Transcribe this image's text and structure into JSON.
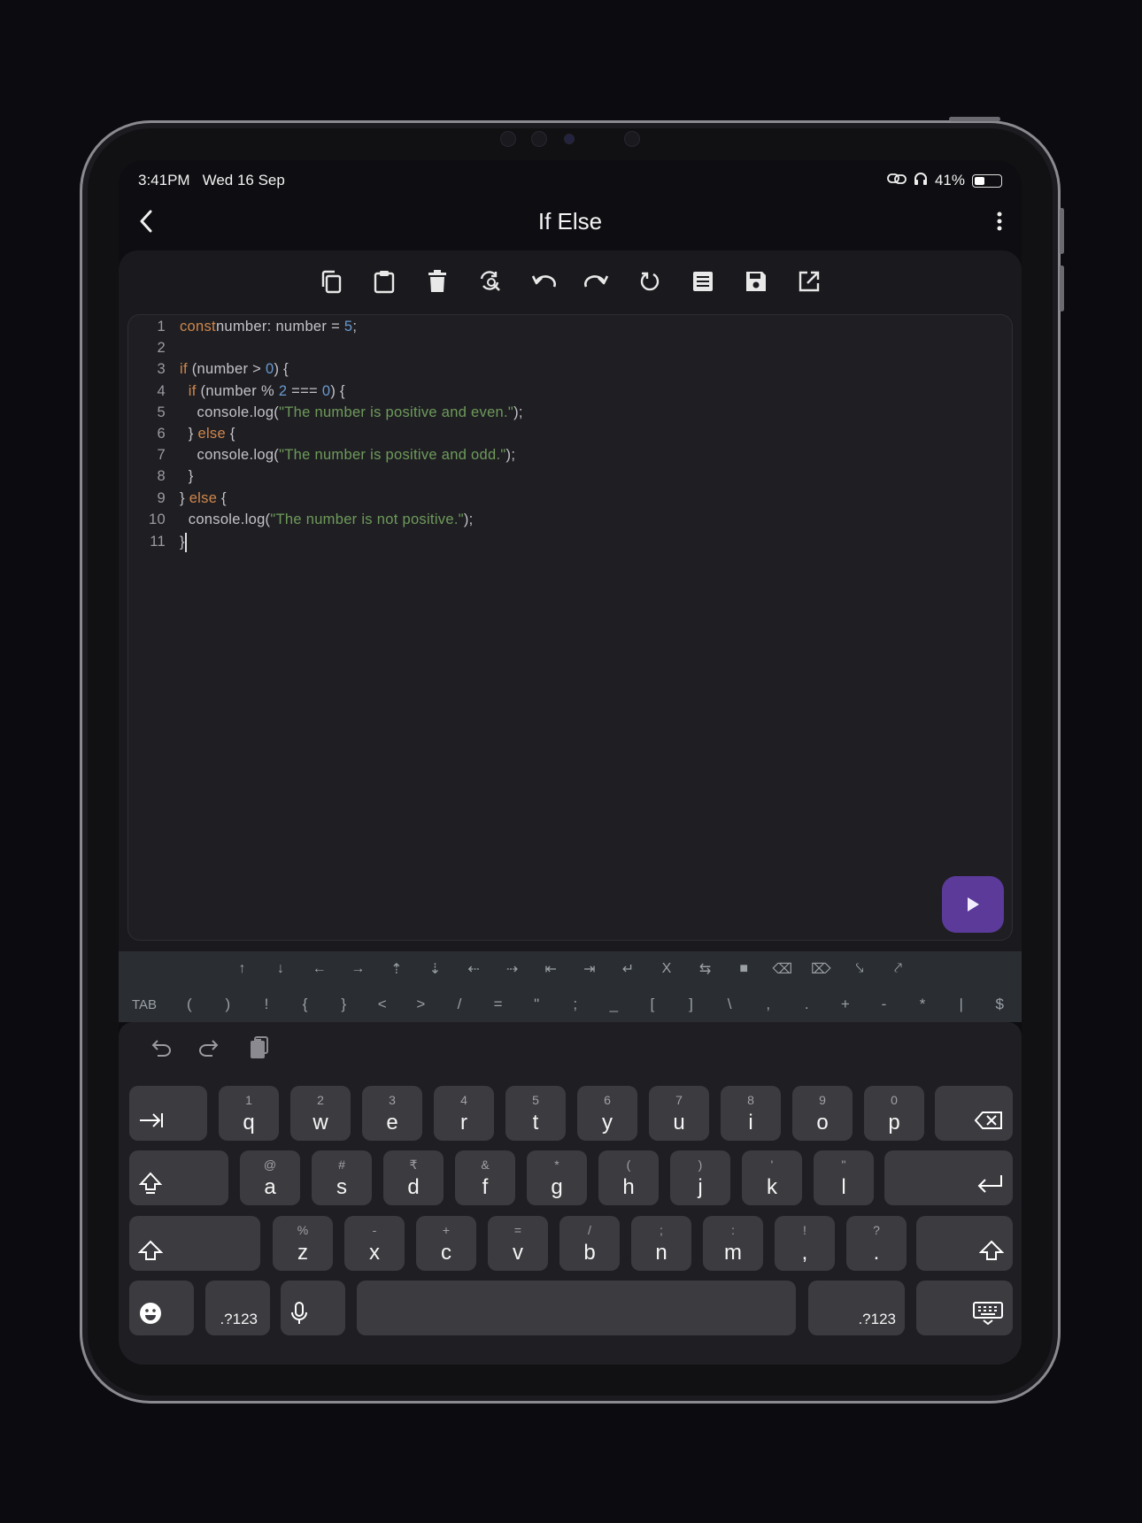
{
  "status_bar": {
    "time": "3:41PM",
    "date": "Wed 16 Sep",
    "battery": "41%",
    "battery_level": 0.41
  },
  "app_bar": {
    "title": "If Else",
    "back_icon": "chevron-left-icon",
    "menu_icon": "more-vertical-icon"
  },
  "toolbar": [
    "copy-icon",
    "paste-icon",
    "delete-icon",
    "replace-icon",
    "undo-icon",
    "redo-icon",
    "refresh-icon",
    "format-icon",
    "save-icon",
    "open-external-icon"
  ],
  "editor": {
    "lines": [
      {
        "n": "1",
        "tokens": [
          [
            "kw",
            "const"
          ],
          [
            "",
            "number: number = "
          ],
          [
            "num",
            "5"
          ],
          [
            "",
            ";"
          ]
        ]
      },
      {
        "n": "2",
        "tokens": []
      },
      {
        "n": "3",
        "tokens": [
          [
            "kw",
            "if"
          ],
          [
            "",
            " (number > "
          ],
          [
            "num",
            "0"
          ],
          [
            "",
            ") {"
          ]
        ]
      },
      {
        "n": "4",
        "tokens": [
          [
            "",
            "  "
          ],
          [
            "kw",
            "if"
          ],
          [
            "",
            " (number % "
          ],
          [
            "num",
            "2"
          ],
          [
            "",
            " === "
          ],
          [
            "num",
            "0"
          ],
          [
            "",
            ") {"
          ]
        ]
      },
      {
        "n": "5",
        "tokens": [
          [
            "",
            "    console.log("
          ],
          [
            "str",
            "\"The number is positive and even.\""
          ],
          [
            "",
            ");"
          ]
        ]
      },
      {
        "n": "6",
        "tokens": [
          [
            "",
            "  } "
          ],
          [
            "kw",
            "else"
          ],
          [
            "",
            " {"
          ]
        ]
      },
      {
        "n": "7",
        "tokens": [
          [
            "",
            "    console.log("
          ],
          [
            "str",
            "\"The number is positive and odd.\""
          ],
          [
            "",
            ");"
          ]
        ]
      },
      {
        "n": "8",
        "tokens": [
          [
            "",
            "  }"
          ]
        ]
      },
      {
        "n": "9",
        "tokens": [
          [
            "",
            "} "
          ],
          [
            "kw",
            "else"
          ],
          [
            "",
            " {"
          ]
        ]
      },
      {
        "n": "10",
        "tokens": [
          [
            "",
            "  console.log("
          ],
          [
            "str",
            "\"The number is not positive.\""
          ],
          [
            "",
            ");"
          ]
        ]
      },
      {
        "n": "11",
        "tokens": [
          [
            "",
            "}"
          ]
        ]
      }
    ],
    "run_icon": "play-icon"
  },
  "extra_keys_row1": [
    "↑",
    "↓",
    "←",
    "→",
    "⇡",
    "⇣",
    "⇠",
    "⇢",
    "⇤",
    "⇥",
    "↵",
    "X",
    "⇆",
    "■",
    "⌫",
    "⌦",
    "⤥",
    "⤤"
  ],
  "extra_keys_row2": [
    "TAB",
    "(",
    ")",
    "!",
    "{",
    "}",
    "<",
    ">",
    "/",
    "=",
    "\"",
    ";",
    "_",
    "[",
    "]",
    "\\",
    ",",
    ".",
    "+",
    "-",
    "*",
    "|",
    "$"
  ],
  "keyboard": {
    "row1": [
      {
        "k": "q",
        "h": "1"
      },
      {
        "k": "w",
        "h": "2"
      },
      {
        "k": "e",
        "h": "3"
      },
      {
        "k": "r",
        "h": "4"
      },
      {
        "k": "t",
        "h": "5"
      },
      {
        "k": "y",
        "h": "6"
      },
      {
        "k": "u",
        "h": "7"
      },
      {
        "k": "i",
        "h": "8"
      },
      {
        "k": "o",
        "h": "9"
      },
      {
        "k": "p",
        "h": "0"
      }
    ],
    "row2": [
      {
        "k": "a",
        "h": "@"
      },
      {
        "k": "s",
        "h": "#"
      },
      {
        "k": "d",
        "h": "₹"
      },
      {
        "k": "f",
        "h": "&"
      },
      {
        "k": "g",
        "h": "*"
      },
      {
        "k": "h",
        "h": "("
      },
      {
        "k": "j",
        "h": ")"
      },
      {
        "k": "k",
        "h": "'"
      },
      {
        "k": "l",
        "h": "\""
      }
    ],
    "row3": [
      {
        "k": "z",
        "h": "%"
      },
      {
        "k": "x",
        "h": "-"
      },
      {
        "k": "c",
        "h": "+"
      },
      {
        "k": "v",
        "h": "="
      },
      {
        "k": "b",
        "h": "/"
      },
      {
        "k": "n",
        "h": ";"
      },
      {
        "k": "m",
        "h": ":"
      },
      {
        "k": ",",
        "h": "!"
      },
      {
        "k": ".",
        "h": "?"
      }
    ],
    "symbols_label": ".?123"
  },
  "colors": {
    "keyword": "#d0874c",
    "number": "#6a9ad0",
    "string": "#6e9a5a",
    "run_button": "#5b3a9a"
  }
}
